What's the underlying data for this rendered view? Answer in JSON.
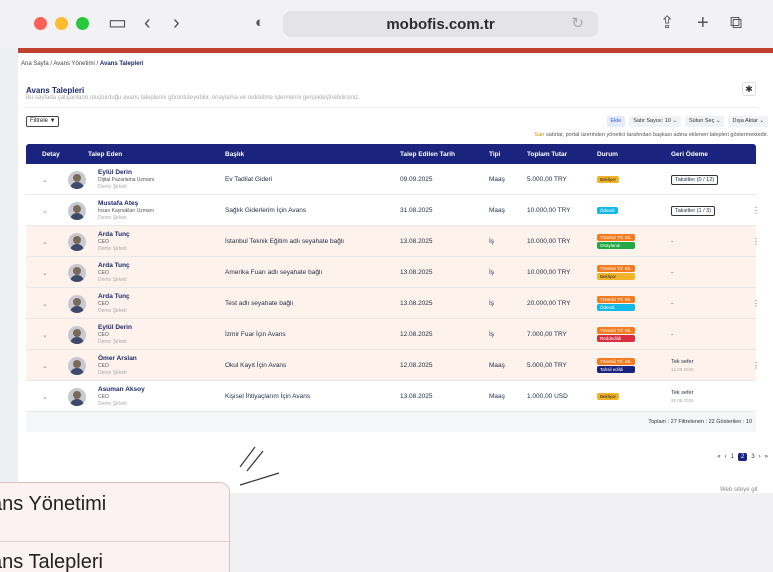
{
  "browser": {
    "url": "mobofis.com.tr"
  },
  "breadcrumb": {
    "home": "Ana Sayfa",
    "sep": "/",
    "section": "Avans Yönetimi",
    "current": "Avans Talepleri"
  },
  "header": {
    "title": "Avans Talepleri",
    "subtitle": "Bu sayfada çalışanların oluşturduğu avans taleplerini görüntüleyebilir, onaylama ve reddetme işlemlerini gerçekleştirebilirsiniz."
  },
  "toolbar": {
    "filter": "Filtrele ▼",
    "excel": "Ekle",
    "row_count": "Satır Sayısı: 10 ⌄",
    "column_select": "Sütun Seç ⌄",
    "export": "Dışa Aktar ⌄"
  },
  "note": {
    "highlight": "Sarı",
    "text": " satırlar, portal üzerinden yönetici tarafından başkası adına eklenen talepleri göstermektedir."
  },
  "table": {
    "headers": [
      "Detay",
      "Talep Eden",
      "Başlık",
      "Talep Edilen Tarih",
      "Tipi",
      "Toplam Tutar",
      "Durum",
      "Geri Ödeme"
    ],
    "rows": [
      {
        "name": "Eylül Derin",
        "role": "Dijital Pazarlama Uzmanı",
        "company": "Demo Şirketi",
        "title": "Ev Tadilat Gideri",
        "date": "09.09.2025",
        "type": "Maaş",
        "amount": "5.000,00 TRY",
        "status": [
          "Bekliyor"
        ],
        "refund": "Taksitler (0 / 12)",
        "peach": false
      },
      {
        "name": "Mustafa Ateş",
        "role": "İnsan Kaynakları Uzmanı",
        "company": "Demo Şirketi",
        "title": "Sağlık Giderlerim İçin Avans",
        "date": "31.08.2025",
        "type": "Maaş",
        "amount": "10.000,00 TRY",
        "status": [
          "Ödendi"
        ],
        "refund": "Taksitler (1 / 3)",
        "peach": false
      },
      {
        "name": "Arda Tunç",
        "role": "CEO",
        "company": "Demo Şirketi",
        "title": "İstanbul Teknik Eğitim adlı seyahate bağlı",
        "date": "13.08.2025",
        "type": "İş",
        "amount": "10.000,00 TRY",
        "status": [
          "Yönetici Trf. Ek.",
          "Onaylandı"
        ],
        "refund": "-",
        "peach": true
      },
      {
        "name": "Arda Tunç",
        "role": "CEO",
        "company": "Demo Şirketi",
        "title": "Amerika Fuarı adlı seyahate bağlı",
        "date": "13.08.2025",
        "type": "İş",
        "amount": "10.000,00 TRY",
        "status": [
          "Yönetici Trf. Ek.",
          "Bekliyor"
        ],
        "refund": "-",
        "peach": true
      },
      {
        "name": "Arda Tunç",
        "role": "CEO",
        "company": "Demo Şirketi",
        "title": "Test adlı seyahate bağlı",
        "date": "13.08.2025",
        "type": "İş",
        "amount": "20.000,00 TRY",
        "status": [
          "Yönetici Trf. Ek.",
          "Ödendi"
        ],
        "refund": "-",
        "peach": true
      },
      {
        "name": "Eylül Derin",
        "role": "CEO",
        "company": "Demo Şirketi",
        "title": "İzmir Fuar İçin Avans",
        "date": "12.08.2025",
        "type": "İş",
        "amount": "7.000,00 TRY",
        "status": [
          "Yönetici Trf. Ek.",
          "Reddedildi"
        ],
        "refund": "-",
        "peach": true
      },
      {
        "name": "Ömer Arslan",
        "role": "CEO",
        "company": "Demo Şirketi",
        "title": "Okul Kayıt İçin Avans",
        "date": "12.08.2025",
        "type": "Maaş",
        "amount": "5.000,00 TRY",
        "status": [
          "Yönetici Trf. Ek.",
          "Tahsil edildi"
        ],
        "refund": "Tek sefer",
        "refund_date": "12.08.2025",
        "peach": true
      },
      {
        "name": "Asuman Aksoy",
        "role": "CEO",
        "company": "Demo Şirketi",
        "title": "Kişisel İhtiyaçlarım İçin Avans",
        "date": "13.08.2025",
        "type": "Maaş",
        "amount": "1.000,00 USD",
        "status": [
          "Bekliyor"
        ],
        "refund": "Tek sefer",
        "refund_date": "25.08.2025",
        "peach": false
      }
    ],
    "footer": "Toplam : 27   Filtrelenen : 22   Gösterilen : 10"
  },
  "pager": {
    "first": "«",
    "prev": "‹",
    "p1": "1",
    "p2": "2",
    "p3": "3",
    "next": "›",
    "last": "»"
  },
  "web_link": "Web siteye git",
  "zoom": {
    "line1": "ans Yönetimi",
    "line2": "ans Talepleri"
  }
}
